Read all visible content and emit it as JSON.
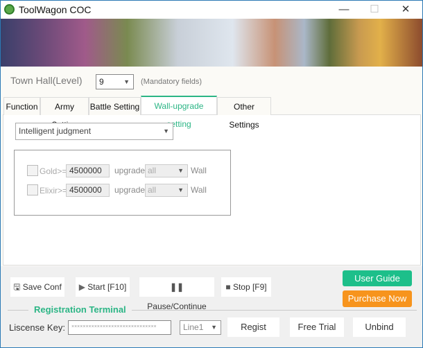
{
  "window": {
    "title": "ToolWagon COC",
    "minimize": "—",
    "maximize": "☐",
    "close": "✕"
  },
  "townhall": {
    "label": "Town Hall(Level)",
    "value": "9",
    "note": "(Mandatory fields)"
  },
  "tabs": [
    {
      "label": "Function"
    },
    {
      "label": "Army Setting"
    },
    {
      "label": "Battle Setting"
    },
    {
      "label": "Wall-upgrade setting",
      "active": true
    },
    {
      "label": "Other Settings"
    }
  ],
  "wall": {
    "mode": "Intelligent judgment",
    "rows": [
      {
        "label": "Gold>=",
        "amount": "4500000",
        "upgrade": "upgrade",
        "target": "all",
        "suffix": "Wall"
      },
      {
        "label": "Elixir>=",
        "amount": "4500000",
        "upgrade": "upgrade",
        "target": "all",
        "suffix": "Wall"
      }
    ]
  },
  "controls": {
    "save": "Save Conf",
    "start": "Start [F10]",
    "pause": "Pause/Continue",
    "stop": "Stop [F9]",
    "guide": "User Guide",
    "purchase": "Purchase Now"
  },
  "registration": {
    "title": "Registration Terminal",
    "key_label": "Liscense Key:",
    "key_value": "××××××××××××××××××××××××××××××",
    "line": "Line1",
    "regist": "Regist",
    "trial": "Free Trial",
    "unbind": "Unbind"
  },
  "colors": {
    "accent": "#2bb585",
    "guide": "#1dbf8a",
    "purchase": "#f7941d"
  }
}
